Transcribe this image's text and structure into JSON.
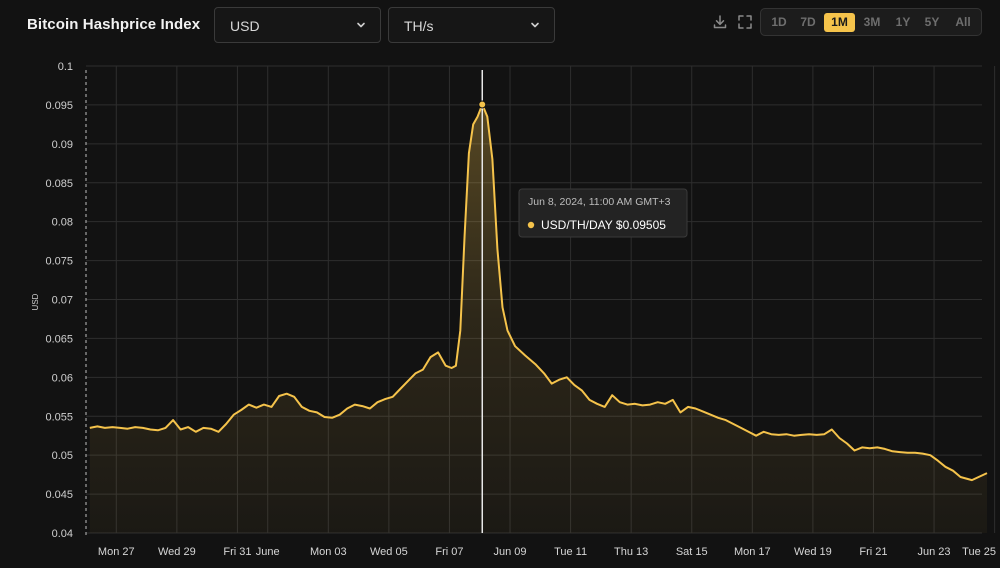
{
  "header": {
    "title": "Bitcoin Hashprice Index",
    "currency_select": "USD",
    "unit_select": "TH/s",
    "ranges": [
      {
        "label": "1D",
        "active": false
      },
      {
        "label": "7D",
        "active": false
      },
      {
        "label": "1M",
        "active": true
      },
      {
        "label": "3M",
        "active": false
      },
      {
        "label": "1Y",
        "active": false
      },
      {
        "label": "5Y",
        "active": false
      },
      {
        "label": "All",
        "active": false
      }
    ]
  },
  "colors": {
    "line": "#f5c34b",
    "accent": "#f5c34b",
    "background": "#121212",
    "grid": "#2e2e2e"
  },
  "tooltip": {
    "date": "Jun 8, 2024, 11:00 AM GMT+3",
    "label": "USD/TH/DAY $0.09505"
  },
  "chart_data": {
    "type": "area",
    "ylabel": "USD",
    "ylim": [
      0.04,
      0.1
    ],
    "y_ticks": [
      "0.1",
      "0.095",
      "0.09",
      "0.085",
      "0.08",
      "0.075",
      "0.07",
      "0.065",
      "0.06",
      "0.055",
      "0.05",
      "0.045",
      "0.04"
    ],
    "x_ticks": [
      "Mon 27",
      "Wed 29",
      "Fri 31",
      "June",
      "Mon 03",
      "Wed 05",
      "Fri 07",
      "Jun 09",
      "Tue 11",
      "Thu 13",
      "Sat 15",
      "Mon 17",
      "Wed 19",
      "Fri 21",
      "Jun 23",
      "Tue 25"
    ],
    "grid": true,
    "highlight": {
      "x": "2024-06-08",
      "y": 0.09505
    },
    "series": [
      {
        "values": [
          [
            "2024-05-26",
            0.0535
          ],
          [
            "2024-05-26",
            0.0537
          ],
          [
            "2024-05-26",
            0.0535
          ],
          [
            "2024-05-26",
            0.0536
          ],
          [
            "2024-05-27",
            0.0535
          ],
          [
            "2024-05-27",
            0.0534
          ],
          [
            "2024-05-27",
            0.0536
          ],
          [
            "2024-05-27",
            0.0535
          ],
          [
            "2024-05-28",
            0.0533
          ],
          [
            "2024-05-28",
            0.0532
          ],
          [
            "2024-05-28",
            0.0535
          ],
          [
            "2024-05-28",
            0.0545
          ],
          [
            "2024-05-29",
            0.0533
          ],
          [
            "2024-05-29",
            0.0536
          ],
          [
            "2024-05-29",
            0.053
          ],
          [
            "2024-05-29",
            0.0535
          ],
          [
            "2024-05-30",
            0.0534
          ],
          [
            "2024-05-30",
            0.053
          ],
          [
            "2024-05-30",
            0.054
          ],
          [
            "2024-05-30",
            0.0552
          ],
          [
            "2024-05-31",
            0.0558
          ],
          [
            "2024-05-31",
            0.0565
          ],
          [
            "2024-05-31",
            0.0561
          ],
          [
            "2024-05-31",
            0.0565
          ],
          [
            "2024-06-01",
            0.0562
          ],
          [
            "2024-06-01",
            0.0576
          ],
          [
            "2024-06-01",
            0.0579
          ],
          [
            "2024-06-01",
            0.0575
          ],
          [
            "2024-06-02",
            0.0562
          ],
          [
            "2024-06-02",
            0.0557
          ],
          [
            "2024-06-02",
            0.0555
          ],
          [
            "2024-06-02",
            0.0549
          ],
          [
            "2024-06-03",
            0.0548
          ],
          [
            "2024-06-03",
            0.0552
          ],
          [
            "2024-06-03",
            0.056
          ],
          [
            "2024-06-03",
            0.0565
          ],
          [
            "2024-06-04",
            0.0563
          ],
          [
            "2024-06-04",
            0.056
          ],
          [
            "2024-06-04",
            0.0568
          ],
          [
            "2024-06-04",
            0.0572
          ],
          [
            "2024-06-05",
            0.0575
          ],
          [
            "2024-06-05",
            0.0585
          ],
          [
            "2024-06-05",
            0.0595
          ],
          [
            "2024-06-05",
            0.0605
          ],
          [
            "2024-06-06",
            0.061
          ],
          [
            "2024-06-06",
            0.0626
          ],
          [
            "2024-06-06",
            0.0632
          ],
          [
            "2024-06-06",
            0.0615
          ],
          [
            "2024-06-07",
            0.0612
          ],
          [
            "2024-06-07",
            0.0615
          ],
          [
            "2024-06-07",
            0.066
          ],
          [
            "2024-06-07",
            0.0782
          ],
          [
            "2024-06-07",
            0.0888
          ],
          [
            "2024-06-07",
            0.0925
          ],
          [
            "2024-06-07",
            0.0935
          ],
          [
            "2024-06-08",
            0.09505
          ],
          [
            "2024-06-08",
            0.0935
          ],
          [
            "2024-06-08",
            0.088
          ],
          [
            "2024-06-08",
            0.0765
          ],
          [
            "2024-06-08",
            0.069
          ],
          [
            "2024-06-08",
            0.066
          ],
          [
            "2024-06-09",
            0.064
          ],
          [
            "2024-06-09",
            0.0628
          ],
          [
            "2024-06-09",
            0.0617
          ],
          [
            "2024-06-10",
            0.0605
          ],
          [
            "2024-06-10",
            0.0592
          ],
          [
            "2024-06-10",
            0.0597
          ],
          [
            "2024-06-10",
            0.06
          ],
          [
            "2024-06-11",
            0.059
          ],
          [
            "2024-06-11",
            0.0583
          ],
          [
            "2024-06-11",
            0.0571
          ],
          [
            "2024-06-11",
            0.0566
          ],
          [
            "2024-06-12",
            0.0562
          ],
          [
            "2024-06-12",
            0.0577
          ],
          [
            "2024-06-12",
            0.0568
          ],
          [
            "2024-06-12",
            0.0565
          ],
          [
            "2024-06-13",
            0.0566
          ],
          [
            "2024-06-13",
            0.0564
          ],
          [
            "2024-06-13",
            0.0565
          ],
          [
            "2024-06-13",
            0.0568
          ],
          [
            "2024-06-14",
            0.0566
          ],
          [
            "2024-06-14",
            0.0571
          ],
          [
            "2024-06-14",
            0.0555
          ],
          [
            "2024-06-14",
            0.0562
          ],
          [
            "2024-06-15",
            0.056
          ],
          [
            "2024-06-15",
            0.0556
          ],
          [
            "2024-06-15",
            0.0552
          ],
          [
            "2024-06-15",
            0.0548
          ],
          [
            "2024-06-16",
            0.0545
          ],
          [
            "2024-06-16",
            0.054
          ],
          [
            "2024-06-16",
            0.0535
          ],
          [
            "2024-06-16",
            0.053
          ],
          [
            "2024-06-17",
            0.0525
          ],
          [
            "2024-06-17",
            0.053
          ],
          [
            "2024-06-17",
            0.0527
          ],
          [
            "2024-06-17",
            0.0526
          ],
          [
            "2024-06-18",
            0.0527
          ],
          [
            "2024-06-18",
            0.0525
          ],
          [
            "2024-06-18",
            0.0526
          ],
          [
            "2024-06-18",
            0.0527
          ],
          [
            "2024-06-19",
            0.0526
          ],
          [
            "2024-06-19",
            0.0527
          ],
          [
            "2024-06-19",
            0.0533
          ],
          [
            "2024-06-19",
            0.0522
          ],
          [
            "2024-06-20",
            0.0515
          ],
          [
            "2024-06-20",
            0.0506
          ],
          [
            "2024-06-20",
            0.051
          ],
          [
            "2024-06-20",
            0.0509
          ],
          [
            "2024-06-21",
            0.051
          ],
          [
            "2024-06-21",
            0.0508
          ],
          [
            "2024-06-21",
            0.0505
          ],
          [
            "2024-06-21",
            0.0504
          ],
          [
            "2024-06-22",
            0.0503
          ],
          [
            "2024-06-22",
            0.0503
          ],
          [
            "2024-06-22",
            0.0502
          ],
          [
            "2024-06-22",
            0.05
          ],
          [
            "2024-06-23",
            0.0493
          ],
          [
            "2024-06-23",
            0.0485
          ],
          [
            "2024-06-23",
            0.048
          ],
          [
            "2024-06-23",
            0.0472
          ],
          [
            "2024-06-24",
            0.0468
          ],
          [
            "2024-06-24",
            0.0477
          ]
        ]
      }
    ]
  }
}
